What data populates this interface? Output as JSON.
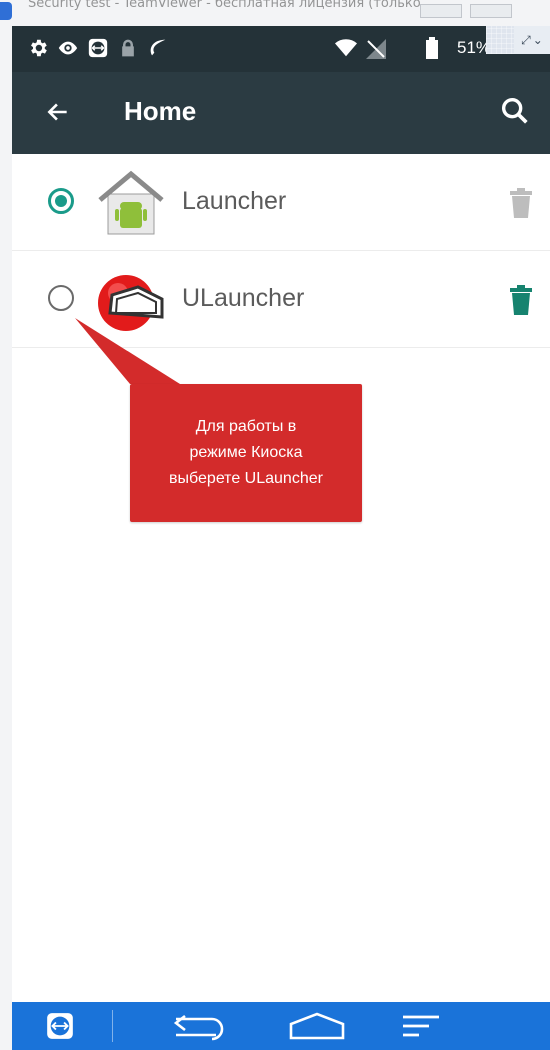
{
  "window": {
    "title": "Security test - TeamViewer - бесплатная лицензия (только"
  },
  "statusbar": {
    "battery_text": "51%",
    "icons": [
      "settings-icon",
      "eye-icon",
      "teamviewer-icon",
      "lock-icon",
      "leaf-icon",
      "wifi-icon",
      "no-signal-icon",
      "battery-icon"
    ]
  },
  "toolbar": {
    "title": "Home",
    "back_icon": "arrow-left-icon",
    "search_icon": "search-icon"
  },
  "apps": [
    {
      "label": "Launcher",
      "selected": true,
      "icon": "launcher-android-icon",
      "trash_color": "#bdbdbd"
    },
    {
      "label": "ULauncher",
      "selected": false,
      "icon": "ulauncher-icon",
      "trash_color": "#16836f"
    }
  ],
  "callout": {
    "line1": "Для работы в",
    "line2": "режиме Киоска",
    "line3": "выберете ULauncher",
    "color": "#d32b2b"
  },
  "navbar": {
    "color": "#1a73d9",
    "buttons": [
      "teamviewer-icon",
      "back-icon",
      "home-icon",
      "recents-icon"
    ]
  },
  "colors": {
    "accent": "#1a9b8a",
    "toolbar": "#2b3b42",
    "statusbar": "#243238"
  }
}
